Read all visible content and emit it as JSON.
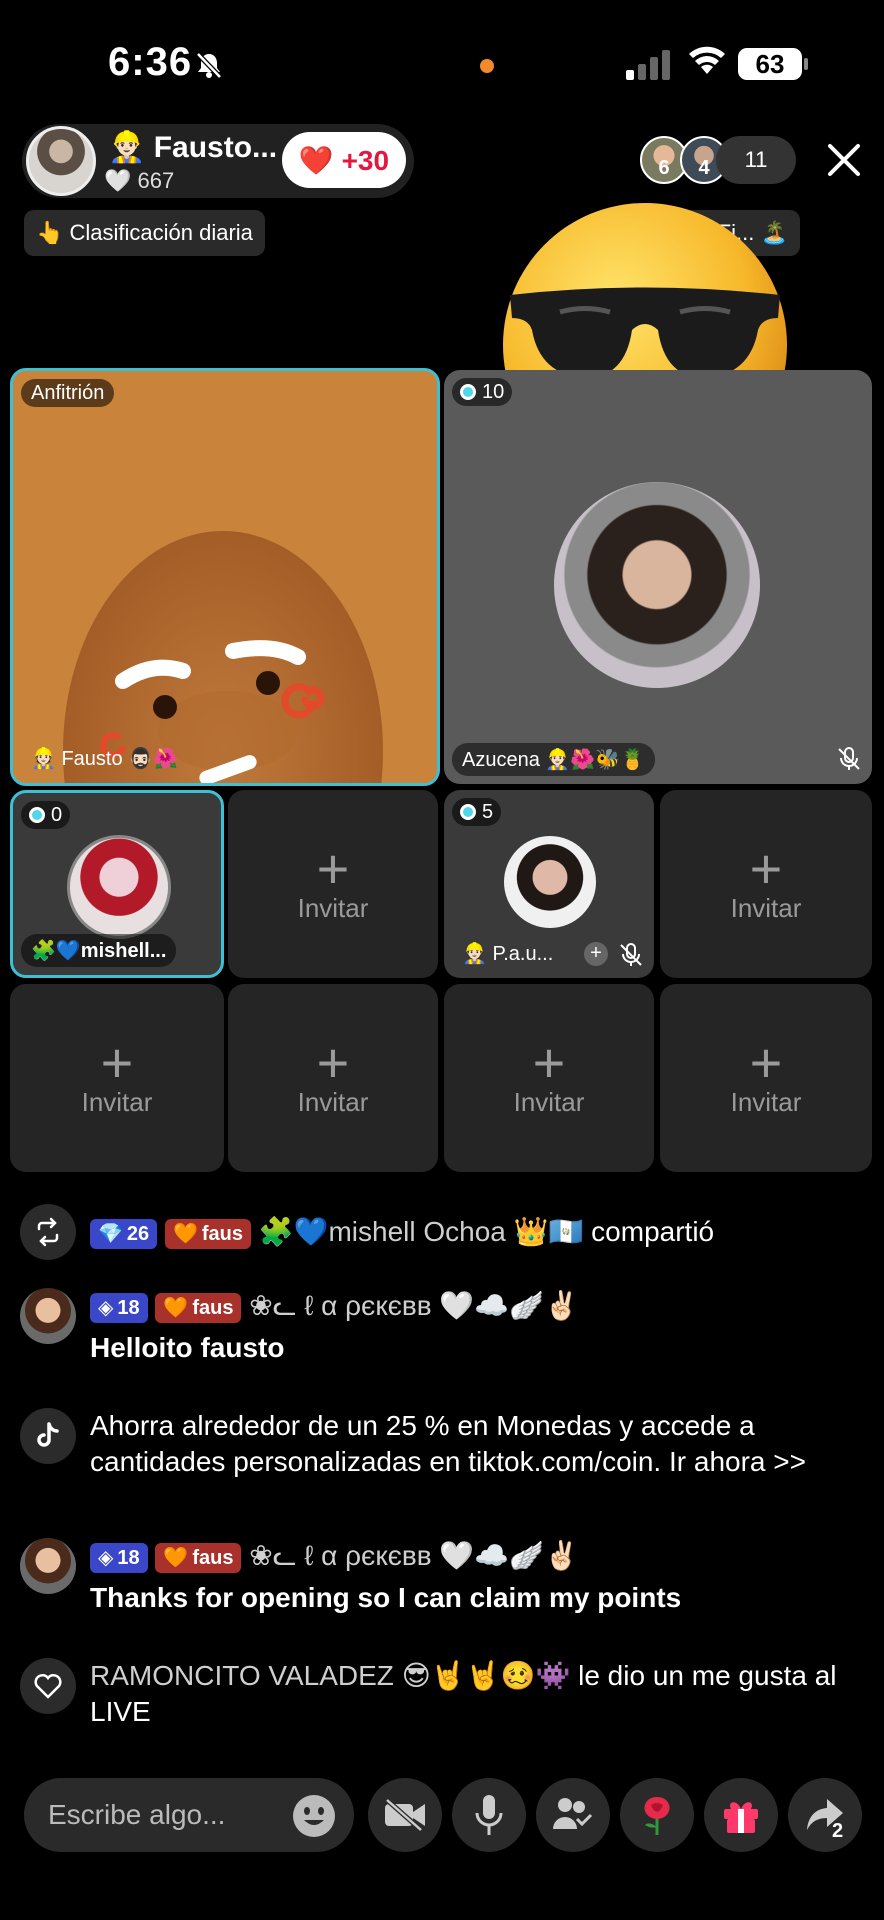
{
  "status_bar": {
    "time": "6:36",
    "battery": "63"
  },
  "host": {
    "name": "👷🏻‍♂️ Fausto...",
    "likes": "🤍 667",
    "plus_label": "❤️ +30"
  },
  "viewers": {
    "avatar_1_badge": "6",
    "avatar_2_badge": "4",
    "count": "11"
  },
  "chips": {
    "daily_ranking": "👆 Clasificación diaria",
    "right_chip": "er Fi... 🏝️"
  },
  "tiles": {
    "host_badge": "Anfitrión",
    "host_name": "👷🏻 Fausto 🧔🏻‍♂️🌺",
    "azucena_score": "10",
    "azucena_name": "Azucena 👷🏻🌺🐝🍍",
    "mishell_score": "0",
    "mishell_name": "🧩💙mishell...",
    "pau_score": "5",
    "pau_name": "👷🏻 P.a.u...",
    "invite_label": "Invitar",
    "invite_plus": "+"
  },
  "chat": [
    {
      "level": "26",
      "fan": "faus",
      "user": "🧩💙mishell Ochoa 👑🇬🇹",
      "action": "compartió"
    },
    {
      "level": "18",
      "fan": "faus",
      "user": "❀ᓚ ℓ α ρєкєвв 🤍☁️🪽✌🏻",
      "message": "Helloito fausto"
    },
    {
      "message": "Ahorra alrededor de un 25 % en Monedas y accede a cantidades personalizadas en tiktok.com/coin. Ir ahora >>"
    },
    {
      "level": "18",
      "fan": "faus",
      "user": "❀ᓚ ℓ α ρєкєвв 🤍☁️🪽✌🏻",
      "message": "Thanks for opening so I can claim my points"
    },
    {
      "user": "RAMONCITO VALADEZ 😎🤘🤘🥴👾",
      "action": "le dio un me gusta al LIVE"
    }
  ],
  "input": {
    "placeholder": "Escribe algo..."
  },
  "share_count": "2"
}
